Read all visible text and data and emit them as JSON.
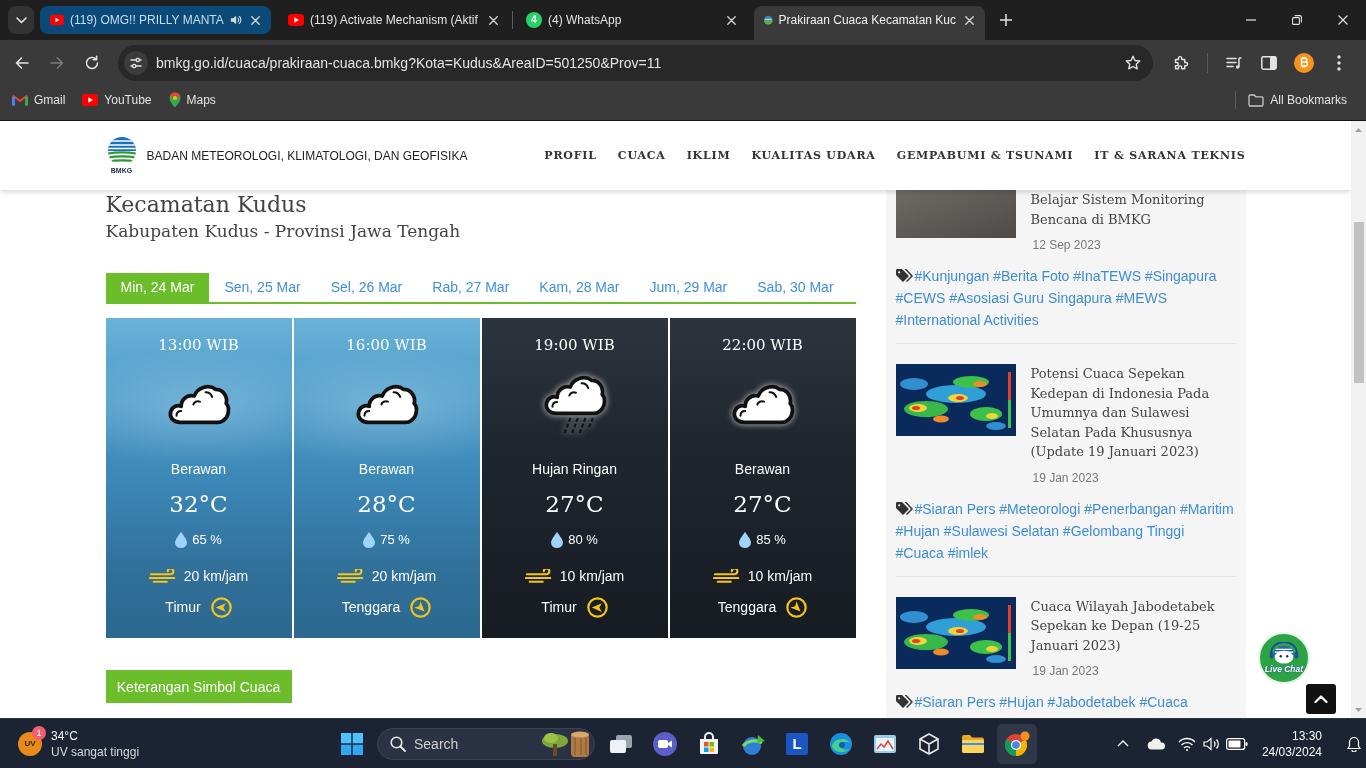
{
  "browser": {
    "tabs": [
      {
        "title": "(119) OMG!! PRILLY MANTA",
        "kind": "youtube",
        "audio": true,
        "highlighted": true,
        "selected": false
      },
      {
        "title": "(119) Activate Mechanism (Aktif",
        "kind": "youtube",
        "audio": false,
        "highlighted": false,
        "selected": false
      },
      {
        "title": "(4) WhatsApp",
        "kind": "whatsapp",
        "badge": "4",
        "audio": false,
        "highlighted": false,
        "selected": false
      },
      {
        "title": "Prakiraan Cuaca Kecamatan Kuc",
        "kind": "globe",
        "audio": false,
        "highlighted": false,
        "selected": true
      }
    ],
    "nav": [
      {
        "kind": "back",
        "disabled": false
      },
      {
        "kind": "forward",
        "disabled": true
      },
      {
        "kind": "reload",
        "disabled": false
      }
    ],
    "url": "bmkg.go.id/cuaca/prakiraan-cuaca.bmkg?Kota=Kudus&AreaID=501250&Prov=11",
    "bookmarks": [
      {
        "label": "Gmail",
        "kind": "mail"
      },
      {
        "label": "YouTube",
        "kind": "youtube"
      },
      {
        "label": "Maps",
        "kind": "pin"
      }
    ],
    "all_bookmarks": "All Bookmarks"
  },
  "site_header": {
    "logo_text": "BMKG",
    "org_name": "BADAN METEOROLOGI, KLIMATOLOGI, DAN GEOFISIKA",
    "nav": [
      "PROFIL",
      "CUACA",
      "IKLIM",
      "KUALITAS UDARA",
      "GEMPABUMI & TSUNAMI",
      "IT & SARANA TEKNIS"
    ]
  },
  "forecast": {
    "heading": "Kecamatan Kudus",
    "subheading": "Kabupaten Kudus - Provinsi Jawa Tengah",
    "days": [
      {
        "label": "Min, 24 Mar",
        "selected": true
      },
      {
        "label": "Sen, 25 Mar",
        "selected": false
      },
      {
        "label": "Sel, 26 Mar",
        "selected": false
      },
      {
        "label": "Rab, 27 Mar",
        "selected": false
      },
      {
        "label": "Kam, 28 Mar",
        "selected": false
      },
      {
        "label": "Jum, 29 Mar",
        "selected": false
      },
      {
        "label": "Sab, 30 Mar",
        "selected": false
      }
    ],
    "periods": [
      {
        "time": "13:00 WIB",
        "kind": "cloudy",
        "night": false,
        "condition": "Berawan",
        "temperature": "32°C",
        "humidity": "65 %",
        "wind_speed": "20 km/jam",
        "wind_direction": "Timur",
        "diagonal": false
      },
      {
        "time": "16:00 WIB",
        "kind": "cloudy",
        "night": false,
        "condition": "Berawan",
        "temperature": "28°C",
        "humidity": "75 %",
        "wind_speed": "20 km/jam",
        "wind_direction": "Tenggara",
        "diagonal": true
      },
      {
        "time": "19:00 WIB",
        "kind": "light-rain",
        "night": true,
        "condition": "Hujan Ringan",
        "temperature": "27°C",
        "humidity": "80 %",
        "wind_speed": "10 km/jam",
        "wind_direction": "Timur",
        "diagonal": false
      },
      {
        "time": "22:00 WIB",
        "kind": "cloudy",
        "night": true,
        "condition": "Berawan",
        "temperature": "27°C",
        "humidity": "85 %",
        "wind_speed": "10 km/jam",
        "wind_direction": "Tenggara",
        "diagonal": true
      }
    ],
    "legend_button": "Keterangan Simbol Cuaca"
  },
  "news": [
    {
      "kind": "photo",
      "title": "Belajar Sistem Monitoring Bencana di BMKG",
      "date": "12 Sep 2023",
      "tags": [
        "#Kunjungan",
        "#Berita Foto",
        "#InaTEWS",
        "#Singapura",
        "#CEWS",
        "#Asosiasi Guru Singapura",
        "#MEWS",
        "#International Activities"
      ]
    },
    {
      "kind": "map",
      "title": "Potensi Cuaca Sepekan Kedepan di Indonesia Pada Umumnya dan Sulawesi Selatan Pada Khususnya (Update 19 Januari 2023)",
      "date": "19 Jan 2023",
      "tags": [
        "#Siaran Pers",
        "#Meteorologi",
        "#Penerbangan",
        "#Maritim",
        "#Hujan",
        "#Sulawesi Selatan",
        "#Gelombang Tinggi",
        "#Cuaca",
        "#imlek"
      ]
    },
    {
      "kind": "map",
      "title": "Cuaca Wilayah Jabodetabek Sepekan ke Depan (19-25 Januari 2023)",
      "date": "19 Jan 2023",
      "tags": [
        "#Siaran Pers",
        "#Hujan",
        "#Jabodetabek",
        "#Cuaca"
      ]
    }
  ],
  "live_chat": {
    "label": "Live Chat"
  },
  "taskbar": {
    "weather": {
      "icon_text": "UV",
      "badge": "1",
      "temperature": "34°C",
      "note": "UV sangat tinggi"
    },
    "search_label": "Search",
    "apps": [
      {
        "kind": "task-view",
        "active": false
      },
      {
        "kind": "video-call",
        "active": false
      },
      {
        "kind": "store",
        "active": false
      },
      {
        "kind": "globe-arrow",
        "active": false
      },
      {
        "kind": "letter",
        "glyph": "L",
        "active": false
      },
      {
        "kind": "swirl",
        "active": false
      },
      {
        "kind": "window-chart",
        "active": false
      },
      {
        "kind": "cube",
        "active": false
      },
      {
        "kind": "folder",
        "active": false
      },
      {
        "kind": "tricolor",
        "active": true
      }
    ],
    "time": "13:30",
    "date": "24/03/2024"
  }
}
